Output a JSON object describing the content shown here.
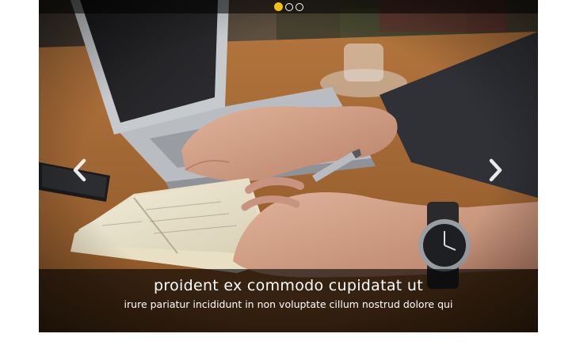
{
  "carousel": {
    "slide_count": 3,
    "active_index": 0,
    "accent_color": "#f4c20d",
    "image": {
      "subject": "hands-writing-notebook-laptop-watch-pen"
    },
    "prev_icon": "chevron-left-icon",
    "next_icon": "chevron-right-icon",
    "caption": {
      "title": "proident ex commodo cupidatat ut",
      "text": "irure pariatur incididunt in non voluptate cillum nostrud dolore qui"
    }
  }
}
